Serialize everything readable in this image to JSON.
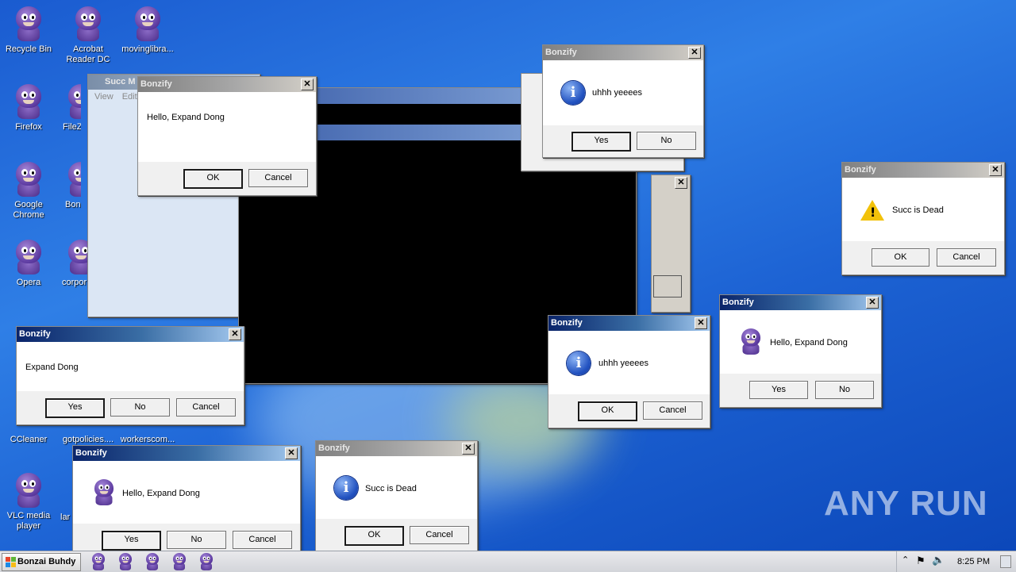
{
  "desktop": {
    "icons": [
      {
        "label": "Recycle Bin"
      },
      {
        "label": "Acrobat Reader DC"
      },
      {
        "label": "movinglibra..."
      },
      {
        "label": "Firefox"
      },
      {
        "label": "FileZilla"
      },
      {
        "label": "Google Chrome"
      },
      {
        "label": "Bonzi"
      },
      {
        "label": "Opera"
      },
      {
        "label": "corpor"
      },
      {
        "label": "CCleaner"
      },
      {
        "label": "gotpolicies...."
      },
      {
        "label": "workerscom..."
      },
      {
        "label": "VLC media player"
      },
      {
        "label": "lar"
      }
    ]
  },
  "background_window": {
    "title": "Succ M",
    "menu": [
      "View",
      "Edit"
    ]
  },
  "dialogs": [
    {
      "title": "Bonzify",
      "message": "Hello, Expand Dong",
      "buttons": [
        "OK",
        "Cancel"
      ],
      "icon": "none"
    },
    {
      "title": "Bonzify",
      "message": "uhhh yeeees",
      "buttons": [
        "Yes",
        "No"
      ],
      "icon": "info-icon"
    },
    {
      "title": "Bonzify",
      "message": "Succ is Dead",
      "buttons": [
        "OK",
        "Cancel"
      ],
      "icon": "warning-icon"
    },
    {
      "title": "Bonzify",
      "message": "Hello, Expand Dong",
      "buttons": [
        "Yes",
        "No"
      ],
      "icon": "bonzi-icon"
    },
    {
      "title": "Bonzify",
      "message": "uhhh yeeees",
      "buttons": [
        "OK",
        "Cancel"
      ],
      "icon": "info-icon"
    },
    {
      "title": "Bonzify",
      "message": "Expand Dong",
      "buttons": [
        "Yes",
        "No",
        "Cancel"
      ],
      "icon": "none"
    },
    {
      "title": "Bonzify",
      "message": "Hello, Expand Dong",
      "buttons": [
        "Yes",
        "No",
        "Cancel"
      ],
      "icon": "bonzi-icon"
    },
    {
      "title": "Bonzify",
      "message": "Succ is Dead",
      "buttons": [
        "OK",
        "Cancel"
      ],
      "icon": "info-icon"
    }
  ],
  "taskbar": {
    "start_label": "Bonzai Buhdy",
    "clock": "8:25 PM"
  },
  "watermark": "ANY RUN"
}
